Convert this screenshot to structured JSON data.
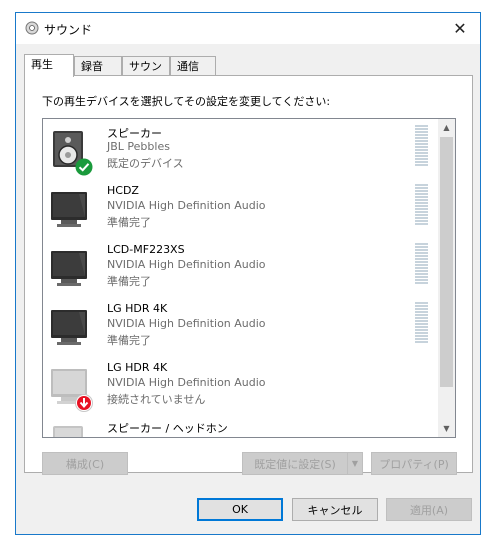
{
  "window": {
    "title": "サウンド",
    "close_glyph": "✕"
  },
  "tabs": [
    {
      "label": "再生"
    },
    {
      "label": "録音"
    },
    {
      "label": "サウンド"
    },
    {
      "label": "通信"
    }
  ],
  "instruction": "下の再生デバイスを選択してその設定を変更してください:",
  "devices": [
    {
      "name": "スピーカー",
      "driver": "JBL Pebbles",
      "status": "既定のデバイス",
      "icon": "speaker-icon",
      "badge": "default-check-icon"
    },
    {
      "name": "HCDZ",
      "driver": "NVIDIA High Definition Audio",
      "status": "準備完了",
      "icon": "monitor-icon"
    },
    {
      "name": "LCD-MF223XS",
      "driver": "NVIDIA High Definition Audio",
      "status": "準備完了",
      "icon": "monitor-icon"
    },
    {
      "name": "LG HDR 4K",
      "driver": "NVIDIA High Definition Audio",
      "status": "準備完了",
      "icon": "monitor-icon"
    },
    {
      "name": "LG HDR 4K",
      "driver": "NVIDIA High Definition Audio",
      "status": "接続されていません",
      "icon": "monitor-disconnected-icon",
      "badge": "disconnected-arrow-icon"
    },
    {
      "name": "スピーカー / ヘッドホン",
      "driver": "",
      "status": "",
      "icon": "speaker-icon"
    }
  ],
  "panel_buttons": {
    "configure": "構成(C)",
    "set_default": "既定値に設定(S)",
    "properties": "プロパティ(P)"
  },
  "dialog_buttons": {
    "ok": "OK",
    "cancel": "キャンセル",
    "apply": "適用(A)"
  },
  "colors": {
    "accent": "#0078d7",
    "check_badge": "#1a9a3c",
    "disconnected_badge": "#e81123"
  }
}
